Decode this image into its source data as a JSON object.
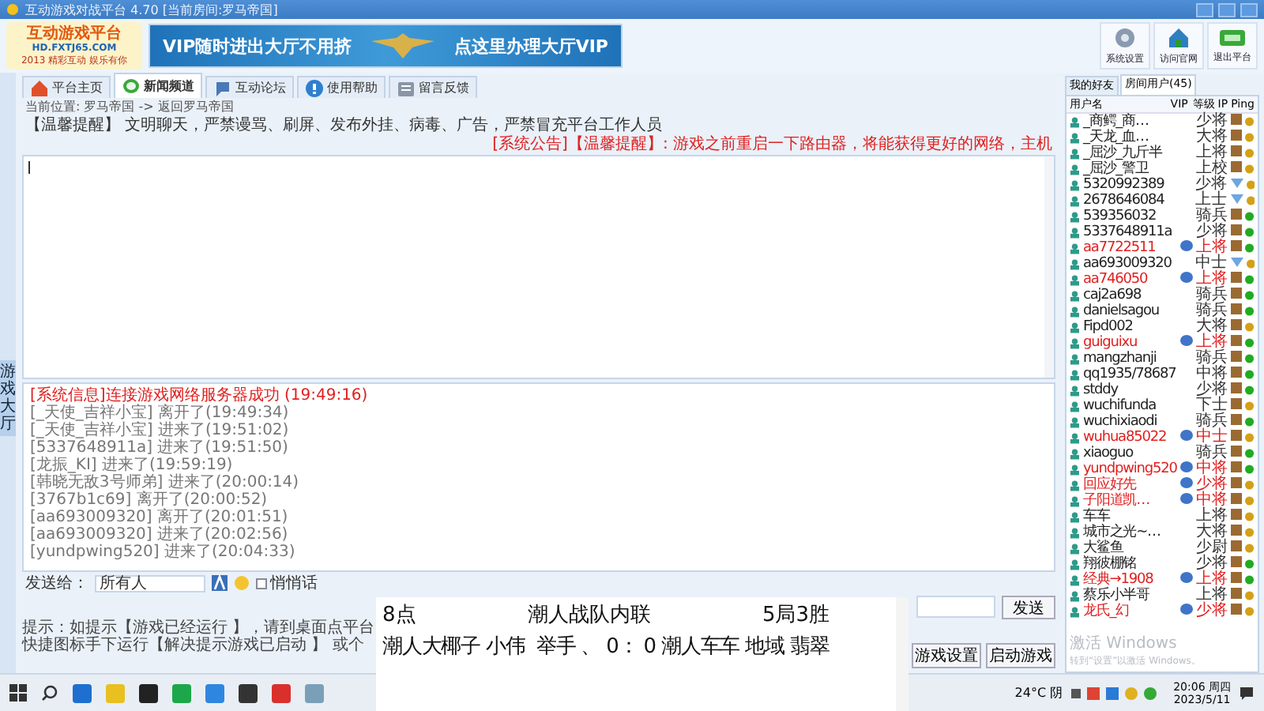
{
  "window": {
    "title": "互动游戏对战平台 4.70 [当前房间:罗马帝国]"
  },
  "logo": {
    "title": "互动游戏平台",
    "url": "HD.FXTJ65.COM",
    "slogan": "2013 精彩互动 娱乐有你"
  },
  "banner": {
    "left": "VIP随时进出大厅不用挤",
    "right": "点这里办理大厅VIP"
  },
  "toolbar": [
    {
      "label": "系统设置",
      "kind": "gear"
    },
    {
      "label": "访问官网",
      "kind": "house"
    },
    {
      "label": "退出平台",
      "kind": "exit"
    }
  ],
  "tabs": [
    {
      "label": "平台主页",
      "kind": "home",
      "selected": false
    },
    {
      "label": "新闻频道",
      "kind": "bubble",
      "selected": true
    },
    {
      "label": "互动论坛",
      "kind": "globe",
      "selected": false
    },
    {
      "label": "使用帮助",
      "kind": "help",
      "selected": false
    },
    {
      "label": "留言反馈",
      "kind": "note",
      "selected": false
    }
  ],
  "side_tab": {
    "label": "游戏大厅"
  },
  "breadcrumb": "当前位置: 罗马帝国 -> 返回罗马帝国",
  "notice": "【温馨提醒】 文明聊天，严禁谩骂、刷屏、发布外挂、病毒、广告，严禁冒充平台工作人员",
  "announcement": "[系统公告]【温馨提醒】: 游戏之前重启一下路由器，将能获得更好的网络，主机",
  "messages": [
    {
      "text": "[系统信息]连接游戏网络服务器成功 (19:49:16)",
      "kind": "system"
    },
    {
      "text": "[_天使_吉祥小宝] 离开了(19:49:34)",
      "kind": "user"
    },
    {
      "text": "[_天使_吉祥小宝] 进来了(19:51:02)",
      "kind": "user"
    },
    {
      "text": "[5337648911a] 进来了(19:51:50)",
      "kind": "user"
    },
    {
      "text": "[龙振_KI] 进来了(19:59:19)",
      "kind": "user"
    },
    {
      "text": "[韩晓无敌3号师弟] 进来了(20:00:14)",
      "kind": "user"
    },
    {
      "text": "[3767b1c69] 离开了(20:00:52)",
      "kind": "user"
    },
    {
      "text": "[aa693009320] 离开了(20:01:51)",
      "kind": "user"
    },
    {
      "text": "[aa693009320] 进来了(20:02:56)",
      "kind": "user"
    },
    {
      "text": "[yundpwing520] 进来了(20:04:33)",
      "kind": "user"
    }
  ],
  "send": {
    "label": "发送给：",
    "recipient": "所有人",
    "whisper": {
      "label": "悄悄话",
      "checked": false
    },
    "button": "发送"
  },
  "tip": "提示：如提示【游戏已经运行 】，请到桌面点平台快捷图标手下运行【解决提示游戏已启动 】 或个",
  "actions": [
    "游戏设置",
    "启动游戏"
  ],
  "user_panel": {
    "tabs": [
      {
        "label": "我的好友",
        "selected": false
      },
      {
        "label": "房间用户(45)",
        "selected": true
      }
    ],
    "columns": [
      "用户名",
      "VIP",
      "等级",
      "IP",
      "Ping"
    ],
    "rows": [
      {
        "name": "_商鳄_商…",
        "vip": false,
        "level": "少将",
        "kind": "box",
        "color": "#d4a017"
      },
      {
        "name": "_天龙_血…",
        "vip": false,
        "level": "大将",
        "kind": "box",
        "color": "#d4a017"
      },
      {
        "name": "_屈沙_九斤半",
        "vip": false,
        "level": "上将",
        "kind": "box",
        "color": "#d4a017"
      },
      {
        "name": "_屈沙_警卫",
        "vip": false,
        "level": "上校",
        "kind": "box",
        "color": "#d4a017"
      },
      {
        "name": "5320992389",
        "vip": false,
        "level": "少将",
        "kind": "net",
        "color": "#d4a017"
      },
      {
        "name": "2678646084",
        "vip": false,
        "level": "上士",
        "kind": "net",
        "color": "#d4a017"
      },
      {
        "name": "539356032",
        "vip": false,
        "level": "骑兵",
        "kind": "box",
        "color": "#22aa22"
      },
      {
        "name": "5337648911a",
        "vip": false,
        "level": "少将",
        "kind": "box",
        "color": "#22aa22"
      },
      {
        "name": "aa7722511",
        "vip": true,
        "level": "上将",
        "kind": "box",
        "color": "#22aa22"
      },
      {
        "name": "aa693009320",
        "vip": false,
        "level": "中士",
        "kind": "net",
        "color": "#d4a017"
      },
      {
        "name": "aa746050",
        "vip": true,
        "level": "上将",
        "kind": "box",
        "color": "#22aa22"
      },
      {
        "name": "caj2a698",
        "vip": false,
        "level": "骑兵",
        "kind": "box",
        "color": "#22aa22"
      },
      {
        "name": "danielsagou",
        "vip": false,
        "level": "骑兵",
        "kind": "box",
        "color": "#22aa22"
      },
      {
        "name": "Fipd002",
        "vip": false,
        "level": "大将",
        "kind": "box",
        "color": "#d4a017"
      },
      {
        "name": "guiguixu",
        "vip": true,
        "level": "上将",
        "kind": "box",
        "color": "#22aa22"
      },
      {
        "name": "mangzhanji",
        "vip": false,
        "level": "骑兵",
        "kind": "box",
        "color": "#22aa22"
      },
      {
        "name": "qq1935/78687",
        "vip": false,
        "level": "中将",
        "kind": "box",
        "color": "#22aa22"
      },
      {
        "name": "stddy",
        "vip": false,
        "level": "少将",
        "kind": "box",
        "color": "#22aa22"
      },
      {
        "name": "wuchifunda",
        "vip": false,
        "level": "下士",
        "kind": "box",
        "color": "#d4a017"
      },
      {
        "name": "wuchixiaodi",
        "vip": false,
        "level": "骑兵",
        "kind": "box",
        "color": "#22aa22"
      },
      {
        "name": "wuhua85022",
        "vip": true,
        "level": "中士",
        "kind": "box",
        "color": "#d4a017"
      },
      {
        "name": "xiaoguo",
        "vip": false,
        "level": "骑兵",
        "kind": "box",
        "color": "#22aa22"
      },
      {
        "name": "yundpwing520",
        "vip": true,
        "level": "中将",
        "kind": "box",
        "color": "#22aa22"
      },
      {
        "name": "回应好先",
        "vip": true,
        "level": "少将",
        "kind": "box",
        "color": "#d4a017"
      },
      {
        "name": "子阳道凯…",
        "vip": true,
        "level": "中将",
        "kind": "box",
        "color": "#d4a017"
      },
      {
        "name": "车车",
        "vip": false,
        "level": "上将",
        "kind": "box",
        "color": "#d4a017"
      },
      {
        "name": "城市之光~…",
        "vip": false,
        "level": "大将",
        "kind": "box",
        "color": "#d4a017"
      },
      {
        "name": "大鲨鱼",
        "vip": false,
        "level": "少尉",
        "kind": "box",
        "color": "#d4a017"
      },
      {
        "name": "翔彼棚铭",
        "vip": false,
        "level": "少将",
        "kind": "box",
        "color": "#22aa22"
      },
      {
        "name": "经典→1908",
        "vip": true,
        "level": "上将",
        "kind": "box",
        "color": "#22aa22"
      },
      {
        "name": "蔡乐小半哥",
        "vip": false,
        "level": "上将",
        "kind": "box",
        "color": "#d4a017"
      },
      {
        "name": "龙氏_幻",
        "vip": true,
        "level": "少将",
        "kind": "box",
        "color": "#d4a017"
      }
    ]
  },
  "watermark": {
    "title": "激活 Windows",
    "hint": "转到“设置”以激活 Windows。"
  },
  "overlay": {
    "line1": [
      "8点",
      "潮人战队内联",
      "5局3胜"
    ],
    "line2": "潮人大椰子 小伟  举手 、 0： 0 潮人车车 地域 翡翠"
  },
  "taskbar": {
    "weather": "24°C 阴",
    "time": "20:06 周四",
    "date": "2023/5/11"
  }
}
